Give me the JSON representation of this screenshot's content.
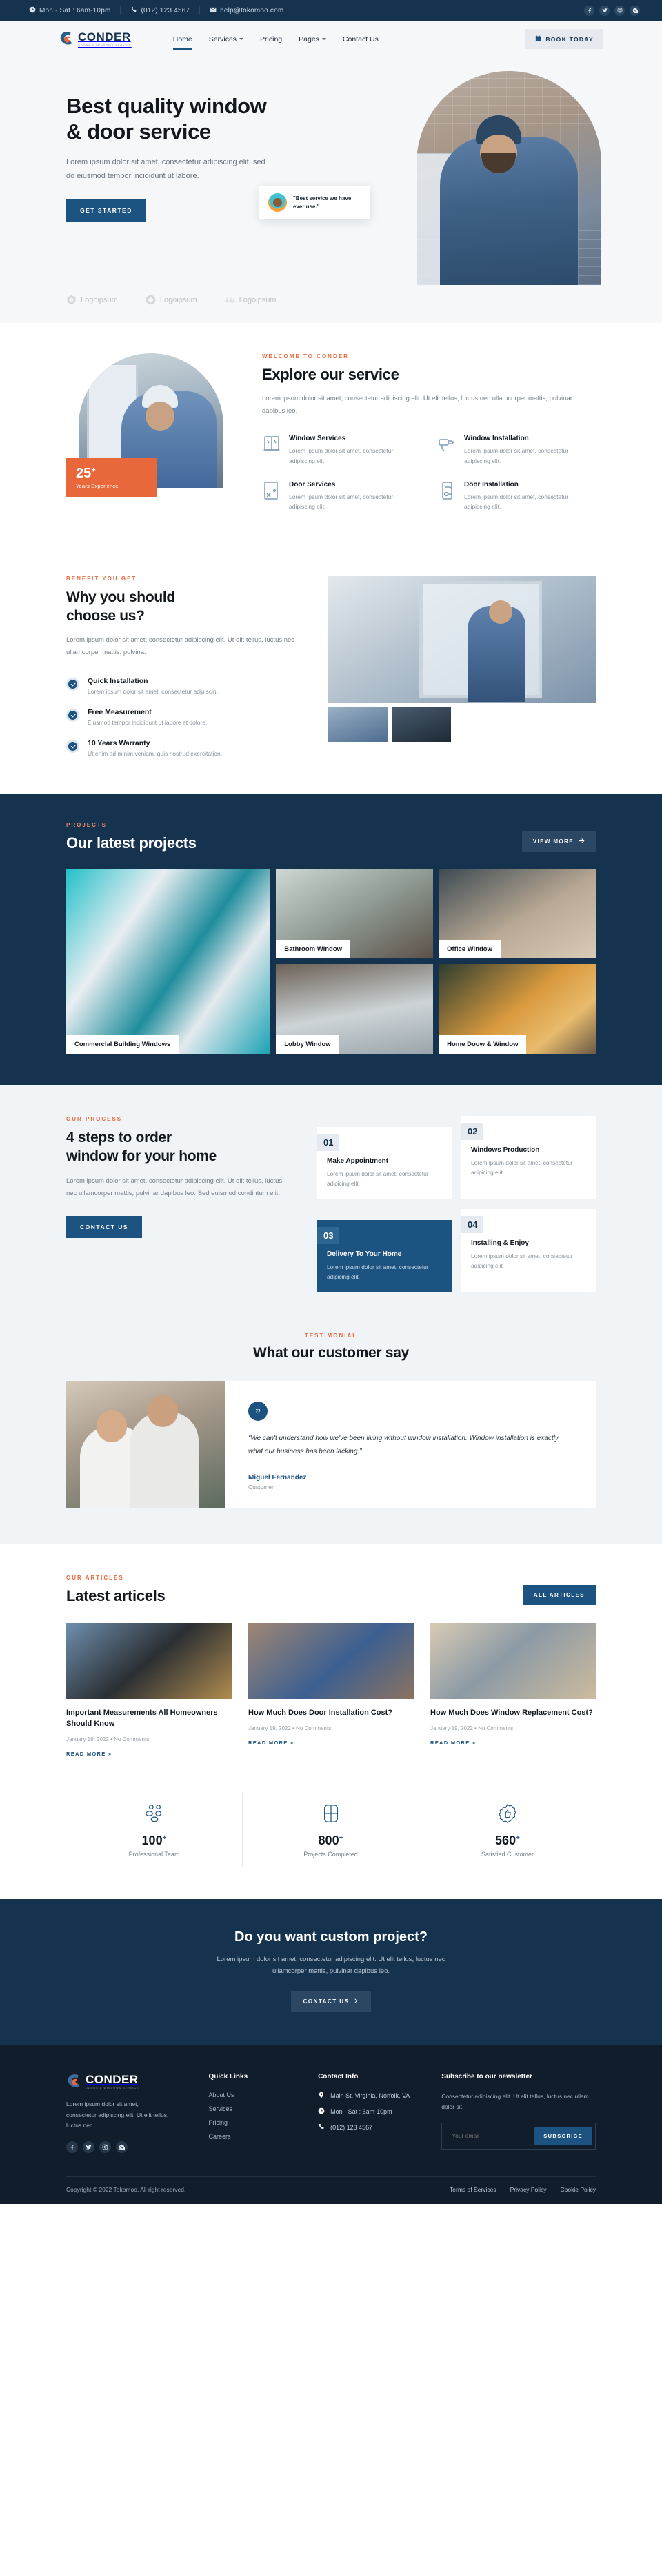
{
  "topbar": {
    "hours": "Mon - Sat : 6am-10pm",
    "phone": "(012) 123 4567",
    "email": "help@tokomoo.com",
    "social": [
      "facebook-icon",
      "twitter-icon",
      "instagram-icon",
      "whatsapp-icon"
    ]
  },
  "brand": {
    "name": "CONDER",
    "tagline": "DOORS & WINDOWS SERVICE"
  },
  "nav": {
    "items": [
      {
        "label": "Home",
        "active": true,
        "caret": false
      },
      {
        "label": "Services",
        "active": false,
        "caret": true
      },
      {
        "label": "Pricing",
        "active": false,
        "caret": false
      },
      {
        "label": "Pages",
        "active": false,
        "caret": true
      },
      {
        "label": "Contact Us",
        "active": false,
        "caret": false
      }
    ],
    "cta": "BOOK TODAY"
  },
  "hero": {
    "title_line1": "Best quality window",
    "title_line2": "& door service",
    "desc": "Lorem ipsum dolor sit amet, consectetur adipiscing elit, sed do eiusmod tempor incididunt ut labore.",
    "button": "GET STARTED",
    "chip_quote": "\"Best service we have ever use.\""
  },
  "logos": [
    {
      "label": "Logoipsum"
    },
    {
      "label": "Logoipsum"
    },
    {
      "label": "Logoipsum"
    }
  ],
  "explore": {
    "eyebrow": "WELCOME TO CONDER",
    "title": "Explore our service",
    "desc": "Lorem ipsum dolor sit amet, consectetur adipiscing elit. Ut elit tellus, luctus nec ullamcorper mattis, pulvinar dapibus leo.",
    "badge_number": "25",
    "badge_sup": "+",
    "badge_label": "Years Experience",
    "services": [
      {
        "icon": "window-icon",
        "title": "Window Services",
        "desc": "Lorem ipsum dolor sit amet, consectetur adipiscing elit."
      },
      {
        "icon": "drill-icon",
        "title": "Window Installation",
        "desc": "Lorem ipsum dolor sit amet, consectetur adipiscing elit."
      },
      {
        "icon": "door-tools-icon",
        "title": "Door Services",
        "desc": "Lorem ipsum dolor sit amet, consectetur adipiscing elit."
      },
      {
        "icon": "door-handle-icon",
        "title": "Door Installation",
        "desc": "Lorem ipsum dolor sit amet, consectetur adipiscing elit."
      }
    ]
  },
  "why": {
    "eyebrow": "BENEFIT YOU GET",
    "title_line1": "Why you should",
    "title_line2": "choose us?",
    "desc": "Lorem ipsum dolor sit amet, consectetur adipiscing elit. Ut elit tellus, luctus nec ullamcorper mattis, pulvina.",
    "benefits": [
      {
        "title": "Quick Installation",
        "desc": "Lorem ipsum dolor sit amet, consectetur adipiscin."
      },
      {
        "title": "Free Measurement",
        "desc": "Eiusmod tempor incididunt ut labore et dolore."
      },
      {
        "title": "10 Years Warranty",
        "desc": "Ut enim ad minim veniam, quis nostrud exercitation."
      }
    ]
  },
  "projects": {
    "eyebrow": "PROJECTS",
    "title": "Our latest projects",
    "view_more": "VIEW MORE",
    "tiles": [
      {
        "caption": "Commercial Building Windows"
      },
      {
        "caption": "Bathroom Window"
      },
      {
        "caption": "Office Window"
      },
      {
        "caption": "Lobby Window"
      },
      {
        "caption": "Home Doow & Window"
      }
    ]
  },
  "process": {
    "eyebrow": "OUR PROCESS",
    "title_line1": "4 steps to order",
    "title_line2": "window for your home",
    "desc": "Lorem ipsum dolor sit amet, consectetur adipiscing elit. Ut elit tellus, luctus nec ullamcorper mattis, pulvinar dapibus leo. Sed euismod condintum elit.",
    "button": "CONTACT US",
    "steps": [
      {
        "num": "01",
        "title": "Make Appointment",
        "desc": "Lorem ipsum dolor sit amet, consectetur adipicing elit."
      },
      {
        "num": "02",
        "title": "Windows Production",
        "desc": "Lorem ipsum dolor sit amet, consectetur adipicing elit."
      },
      {
        "num": "03",
        "title": "Delivery To Your Home",
        "desc": "Lorem ipsum dolor sit amet, consectetur adipicing elit."
      },
      {
        "num": "04",
        "title": "Installing & Enjoy",
        "desc": "Lorem ipsum dolor sit amet, consectetur adipicing elit."
      }
    ]
  },
  "testimonial": {
    "eyebrow": "TESTIMONIAL",
    "title": "What our customer say",
    "quote": "“We can't understand how we've been living without window installation. Window installation is exactly what our business has been lacking.”",
    "name": "Miguel Fernandez",
    "role": "Customer"
  },
  "articles": {
    "eyebrow": "OUR ARTICLES",
    "title": "Latest articels",
    "all_label": "ALL ARTICLES",
    "read_more": "READ MORE »",
    "items": [
      {
        "title": "Important Measurements All Homeowners Should Know",
        "meta": "January 19, 2022 • No Comments"
      },
      {
        "title": "How Much Does Door Installation Cost?",
        "meta": "January 19, 2022 • No Comments"
      },
      {
        "title": "How Much Does Window Replacement Cost?",
        "meta": "January 19, 2022 • No Comments"
      }
    ]
  },
  "stats": [
    {
      "icon": "team-icon",
      "value": "100",
      "sup": "+",
      "label": "Professional Team"
    },
    {
      "icon": "window-grid-icon",
      "value": "800",
      "sup": "+",
      "label": "Projects Completed"
    },
    {
      "icon": "thumbs-up-badge-icon",
      "value": "560",
      "sup": "+",
      "label": "Satisfied Customer"
    }
  ],
  "cta": {
    "title": "Do you want custom project?",
    "desc": "Lorem ipsum dolor sit amet, consectetur adipiscing elit. Ut elit tellus, luctus nec ullamcorper mattis, pulvinar dapibus leo.",
    "button": "CONTACT US"
  },
  "footer": {
    "about": "Lorem ipsum dolor sit amet, consectetur adipiscing elit. Ut elit tellus, luctus nec.",
    "social": [
      "facebook-icon",
      "twitter-icon",
      "instagram-icon",
      "whatsapp-icon"
    ],
    "quick_links_title": "Quick Links",
    "quick_links": [
      "About Us",
      "Services",
      "Pricing",
      "Careers"
    ],
    "contact_title": "Contact Info",
    "contact": [
      {
        "icon": "location-pin-icon",
        "text": "Main St. Virginia, Norfolk, VA"
      },
      {
        "icon": "clock-icon",
        "text": "Mon - Sat : 6am-10pm"
      },
      {
        "icon": "phone-icon",
        "text": "(012) 123 4567"
      }
    ],
    "newsletter_title": "Subscribe to our newsletter",
    "newsletter_desc": "Consectetur adipiscing elit. Ut elit tellus, luctus nec ullam dolor sit.",
    "email_placeholder": "Your email",
    "subscribe_label": "SUBSCRIBE",
    "copyright": "Copyright © 2022 Tokomoo, All right reserved.",
    "legal": [
      "Terms of Services",
      "Privacy Policy",
      "Cookie Policy"
    ]
  },
  "colors": {
    "navy": "#15324e",
    "blue": "#1d5380",
    "orange": "#e8683c",
    "footer_bg": "#111d2b"
  }
}
